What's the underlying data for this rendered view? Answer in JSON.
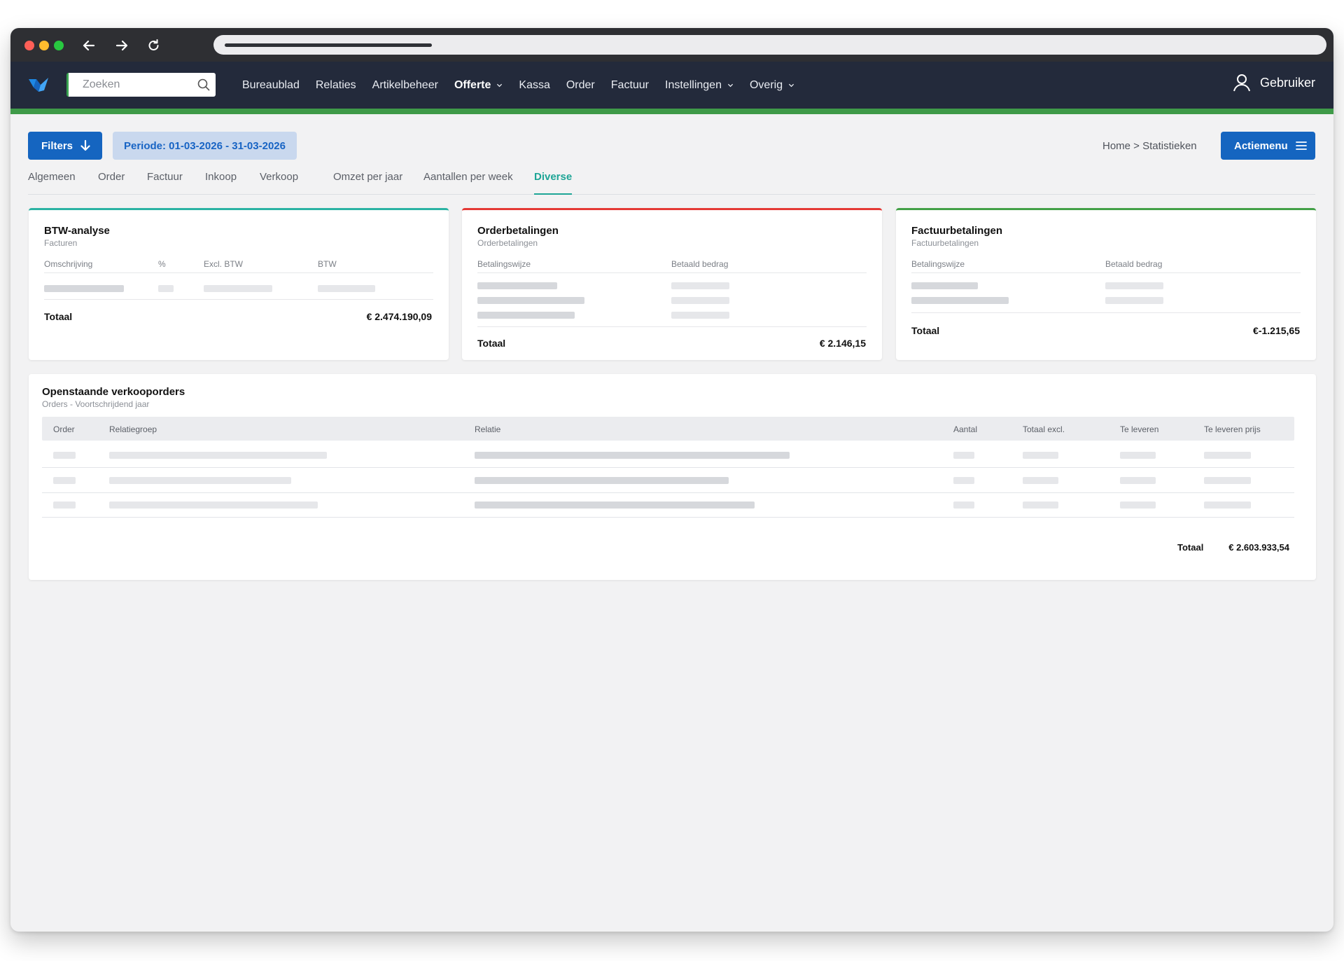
{
  "header": {
    "search_placeholder": "Zoeken",
    "menu": [
      {
        "label": "Bureaublad"
      },
      {
        "label": "Relaties"
      },
      {
        "label": "Artikelbeheer"
      },
      {
        "label": "Offerte",
        "dropdown": true,
        "active": true
      },
      {
        "label": "Kassa"
      },
      {
        "label": "Order"
      },
      {
        "label": "Factuur"
      },
      {
        "label": "Instellingen",
        "dropdown": true
      },
      {
        "label": "Overig",
        "dropdown": true
      }
    ],
    "user_label": "Gebruiker",
    "accent_color": "#3f9a48"
  },
  "toolbar": {
    "filters_label": "Filters",
    "periode_label": "Periode: 01-03-2026 - 31-03-2026",
    "breadcrumb": "Home > Statistieken",
    "actiemenu_label": "Actiemenu"
  },
  "tabs": [
    {
      "label": "Algemeen"
    },
    {
      "label": "Order"
    },
    {
      "label": "Factuur"
    },
    {
      "label": "Inkoop"
    },
    {
      "label": "Verkoop"
    },
    {
      "label": "Omzet per jaar"
    },
    {
      "label": "Aantallen per week"
    },
    {
      "label": "Diverse",
      "active": true
    }
  ],
  "btw": {
    "title": "BTW-analyse",
    "subtitle": "Facturen",
    "columns": [
      "Omschrijving",
      "%",
      "Excl. BTW",
      "BTW"
    ],
    "total_label": "Totaal",
    "total_value": "€ 2.474.190,09",
    "accent": "#2bb3a3"
  },
  "order_payments": {
    "title": "Orderbetalingen",
    "subtitle": "Orderbetalingen",
    "columns": [
      "Betalingswijze",
      "Betaald bedrag"
    ],
    "total_label": "Totaal",
    "total_value": "€ 2.146,15",
    "accent": "#e53935"
  },
  "invoice_payments": {
    "title": "Factuurbetalingen",
    "subtitle": "Factuurbetalingen",
    "columns": [
      "Betalingswijze",
      "Betaald bedrag"
    ],
    "total_label": "Totaal",
    "total_value": "€-1.215,65",
    "accent": "#43a047"
  },
  "open_orders": {
    "title": "Openstaande verkooporders",
    "subtitle": "Orders - Voortschrijdend jaar",
    "columns": [
      "Order",
      "Relatiegroep",
      "Relatie",
      "Aantal",
      "Totaal excl.",
      "Te leveren",
      "Te leveren prijs"
    ],
    "total_label": "Totaal",
    "total_value": "€ 2.603.933,54"
  }
}
